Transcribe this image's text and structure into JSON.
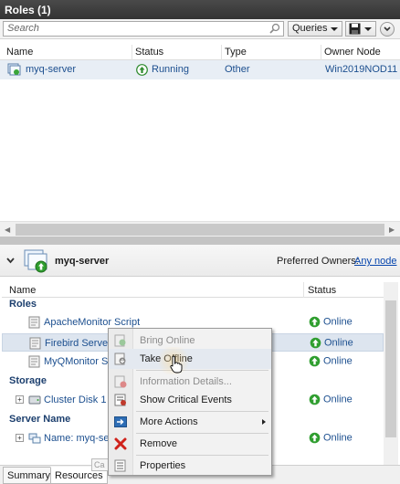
{
  "top_pane": {
    "title": "Roles (1)",
    "search_placeholder": "Search",
    "queries_label": "Queries",
    "columns": [
      "Name",
      "Status",
      "Type",
      "Owner Node"
    ],
    "rows": [
      {
        "name": "myq-server",
        "status": "Running",
        "type": "Other",
        "owner": "Win2019NOD11"
      }
    ]
  },
  "details_pane": {
    "title": "myq-server",
    "preferred_owners_label": "Preferred Owners:",
    "any_node_link": "Any node",
    "columns": [
      "Name",
      "Status"
    ],
    "sections": {
      "roles": "Roles",
      "storage": "Storage",
      "server_name": "Server Name"
    },
    "resources": [
      {
        "name": "ApacheMonitor Script",
        "status": "Online"
      },
      {
        "name": "Firebird Server -",
        "status": "Online"
      },
      {
        "name": "MyQMonitor Scri",
        "status": "Online"
      },
      {
        "name": "Cluster Disk 1",
        "status": "Online"
      },
      {
        "name": "Name: myq-serve",
        "status": "Online"
      }
    ]
  },
  "context_menu": {
    "items": [
      {
        "label": "Bring Online",
        "enabled": false
      },
      {
        "label": "Take Offline",
        "enabled": true
      },
      {
        "label": "Information Details...",
        "enabled": false
      },
      {
        "label": "Show Critical Events",
        "enabled": true
      },
      {
        "label": "More Actions",
        "enabled": true,
        "submenu": true
      },
      {
        "label": "Remove",
        "enabled": true
      },
      {
        "label": "Properties",
        "enabled": true
      }
    ]
  },
  "tooltip_stub": "Ca",
  "tabs": [
    {
      "label": "Summary",
      "active": false
    },
    {
      "label": "Resources",
      "active": true
    }
  ],
  "colors": {
    "header_bg": "#333333",
    "link": "#0645ad",
    "online_green": "#3aa63a",
    "selected_row": "#e8eef5"
  }
}
